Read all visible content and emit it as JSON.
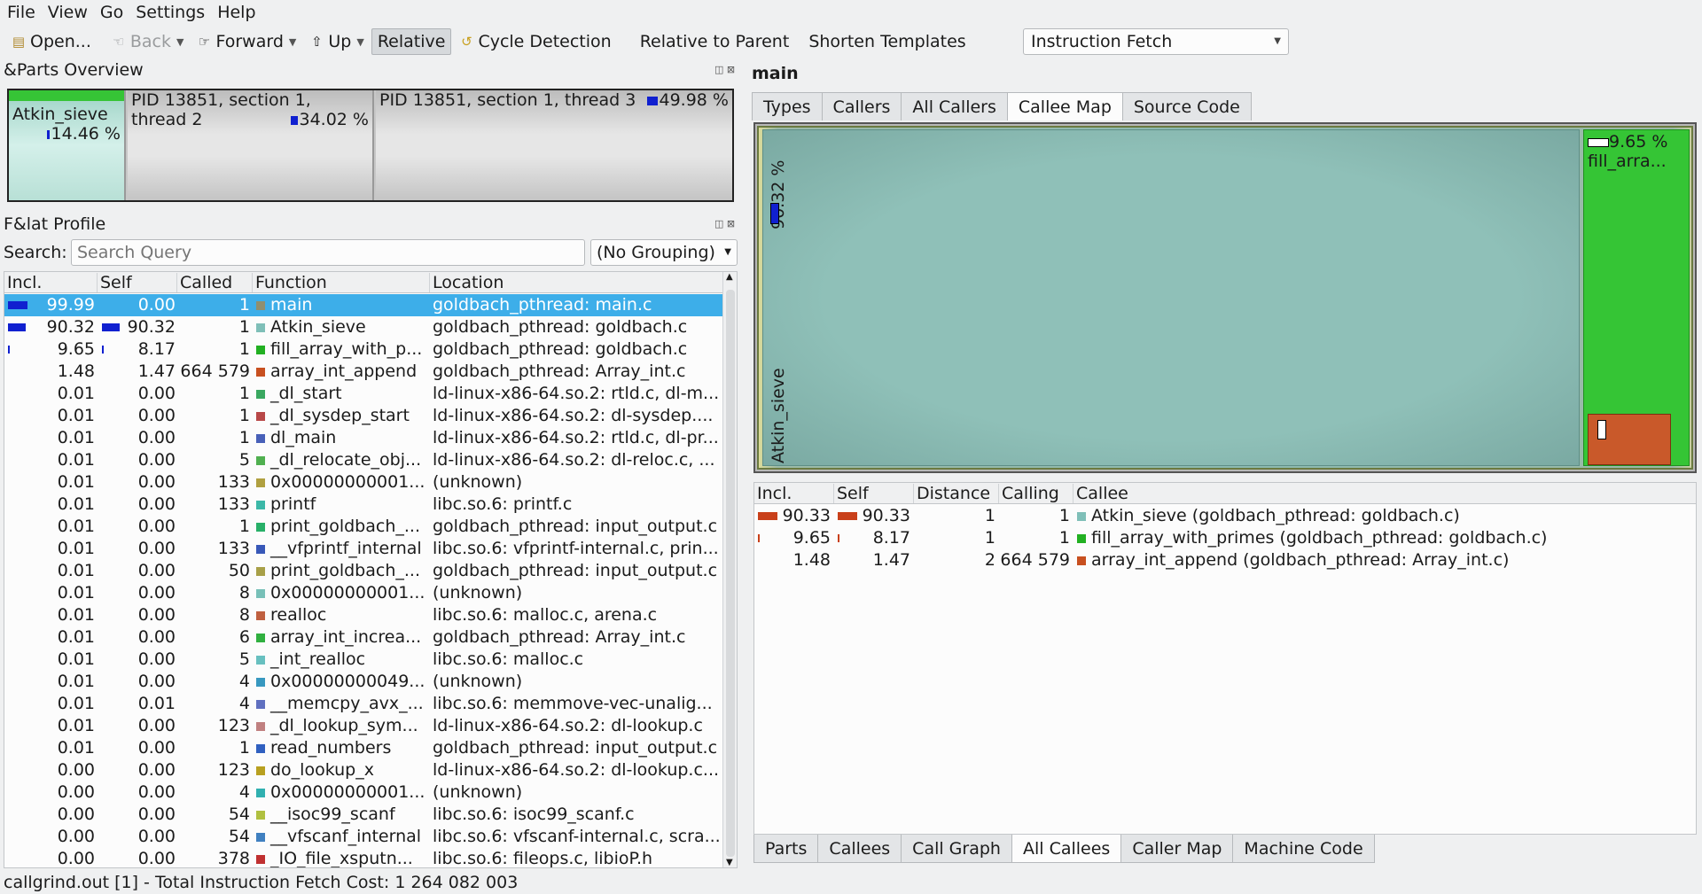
{
  "menu": [
    "File",
    "View",
    "Go",
    "Settings",
    "Help"
  ],
  "toolbar": {
    "open": "Open...",
    "back": "Back",
    "forward": "Forward",
    "up": "Up",
    "relative": "Relative",
    "cycle_detection": "Cycle Detection",
    "relative_to_parent": "Relative to Parent",
    "shorten_templates": "Shorten Templates",
    "event_type": "Instruction Fetch"
  },
  "parts_overview": {
    "title": "&Parts Overview",
    "parts": [
      {
        "label": "Atkin_sieve",
        "pct": "14.46 %"
      },
      {
        "label": "PID 13851, section 1, thread 2",
        "pct": "34.02 %"
      },
      {
        "label": "PID 13851, section 1, thread 3",
        "pct": "49.98 %"
      }
    ]
  },
  "flat_profile": {
    "title": "F&lat Profile",
    "search_label": "Search:",
    "search_placeholder": "Search Query",
    "grouping": "(No Grouping)",
    "columns": [
      "Incl.",
      "Self",
      "Called",
      "Function",
      "Location"
    ],
    "rows": [
      {
        "incl": "99.99",
        "self": "0.00",
        "called": "1",
        "function": "main",
        "location": "goldbach_pthread: main.c",
        "color": "#8f8f6f",
        "incl_bar": 99.99,
        "self_bar": 0
      },
      {
        "incl": "90.32",
        "self": "90.32",
        "called": "1",
        "function": "Atkin_sieve",
        "location": "goldbach_pthread: goldbach.c",
        "color": "#7fbfb8",
        "incl_bar": 90.32,
        "self_bar": 90.32
      },
      {
        "incl": "9.65",
        "self": "8.17",
        "called": "1",
        "function": "fill_array_with_p...",
        "location": "goldbach_pthread: goldbach.c",
        "color": "#22b022",
        "incl_bar": 9.65,
        "self_bar": 8.17
      },
      {
        "incl": "1.48",
        "self": "1.47",
        "called": "664 579",
        "function": "array_int_append",
        "location": "goldbach_pthread: Array_int.c",
        "color": "#c85020",
        "incl_bar": 0,
        "self_bar": 0
      },
      {
        "incl": "0.01",
        "self": "0.00",
        "called": "1",
        "function": "_dl_start",
        "location": "ld-linux-x86-64.so.2: rtld.c, dl-m...",
        "color": "#3aa860",
        "incl_bar": 0,
        "self_bar": 0
      },
      {
        "incl": "0.01",
        "self": "0.00",
        "called": "1",
        "function": "_dl_sysdep_start",
        "location": "ld-linux-x86-64.so.2: dl-sysdep....",
        "color": "#b84848",
        "incl_bar": 0,
        "self_bar": 0
      },
      {
        "incl": "0.01",
        "self": "0.00",
        "called": "1",
        "function": "dl_main",
        "location": "ld-linux-x86-64.so.2: rtld.c, dl-pr...",
        "color": "#4860b8",
        "incl_bar": 0,
        "self_bar": 0
      },
      {
        "incl": "0.01",
        "self": "0.00",
        "called": "5",
        "function": "_dl_relocate_obj...",
        "location": "ld-linux-x86-64.so.2: dl-reloc.c, ...",
        "color": "#50b050",
        "incl_bar": 0,
        "self_bar": 0
      },
      {
        "incl": "0.01",
        "self": "0.00",
        "called": "133",
        "function": "0x00000000001...",
        "location": "(unknown)",
        "color": "#b0a040",
        "incl_bar": 0,
        "self_bar": 0
      },
      {
        "incl": "0.01",
        "self": "0.00",
        "called": "133",
        "function": "printf",
        "location": "libc.so.6: printf.c",
        "color": "#3cb8a8",
        "incl_bar": 0,
        "self_bar": 0
      },
      {
        "incl": "0.01",
        "self": "0.00",
        "called": "1",
        "function": "print_goldbach_...",
        "location": "goldbach_pthread: input_output.c",
        "color": "#28b068",
        "incl_bar": 0,
        "self_bar": 0
      },
      {
        "incl": "0.01",
        "self": "0.00",
        "called": "133",
        "function": "__vfprintf_internal",
        "location": "libc.so.6: vfprintf-internal.c, prin...",
        "color": "#3858b8",
        "incl_bar": 0,
        "self_bar": 0
      },
      {
        "incl": "0.01",
        "self": "0.00",
        "called": "50",
        "function": "print_goldbach_...",
        "location": "goldbach_pthread: input_output.c",
        "color": "#a8a048",
        "incl_bar": 0,
        "self_bar": 0
      },
      {
        "incl": "0.01",
        "self": "0.00",
        "called": "8",
        "function": "0x00000000001...",
        "location": "(unknown)",
        "color": "#78c0b8",
        "incl_bar": 0,
        "self_bar": 0
      },
      {
        "incl": "0.01",
        "self": "0.00",
        "called": "8",
        "function": "realloc",
        "location": "libc.so.6: malloc.c, arena.c",
        "color": "#c06040",
        "incl_bar": 0,
        "self_bar": 0
      },
      {
        "incl": "0.01",
        "self": "0.00",
        "called": "6",
        "function": "array_int_increa...",
        "location": "goldbach_pthread: Array_int.c",
        "color": "#30b040",
        "incl_bar": 0,
        "self_bar": 0
      },
      {
        "incl": "0.01",
        "self": "0.00",
        "called": "5",
        "function": "_int_realloc",
        "location": "libc.so.6: malloc.c",
        "color": "#68c0c0",
        "incl_bar": 0,
        "self_bar": 0
      },
      {
        "incl": "0.01",
        "self": "0.00",
        "called": "4",
        "function": "0x00000000049...",
        "location": "(unknown)",
        "color": "#3898c0",
        "incl_bar": 0,
        "self_bar": 0
      },
      {
        "incl": "0.01",
        "self": "0.01",
        "called": "4",
        "function": "__memcpy_avx_...",
        "location": "libc.so.6: memmove-vec-unalig...",
        "color": "#6070c0",
        "incl_bar": 0,
        "self_bar": 0
      },
      {
        "incl": "0.01",
        "self": "0.00",
        "called": "123",
        "function": "_dl_lookup_sym...",
        "location": "ld-linux-x86-64.so.2: dl-lookup.c",
        "color": "#c08080",
        "incl_bar": 0,
        "self_bar": 0
      },
      {
        "incl": "0.01",
        "self": "0.00",
        "called": "1",
        "function": "read_numbers",
        "location": "goldbach_pthread: input_output.c",
        "color": "#3060c0",
        "incl_bar": 0,
        "self_bar": 0
      },
      {
        "incl": "0.00",
        "self": "0.00",
        "called": "123",
        "function": "do_lookup_x",
        "location": "ld-linux-x86-64.so.2: dl-lookup.c...",
        "color": "#b8a020",
        "incl_bar": 0,
        "self_bar": 0
      },
      {
        "incl": "0.00",
        "self": "0.00",
        "called": "4",
        "function": "0x00000000001...",
        "location": "(unknown)",
        "color": "#30b0b0",
        "incl_bar": 0,
        "self_bar": 0
      },
      {
        "incl": "0.00",
        "self": "0.00",
        "called": "54",
        "function": "__isoc99_scanf",
        "location": "libc.so.6: isoc99_scanf.c",
        "color": "#b0c040",
        "incl_bar": 0,
        "self_bar": 0
      },
      {
        "incl": "0.00",
        "self": "0.00",
        "called": "54",
        "function": "__vfscanf_internal",
        "location": "libc.so.6: vfscanf-internal.c, scra...",
        "color": "#4080c0",
        "incl_bar": 0,
        "self_bar": 0
      },
      {
        "incl": "0.00",
        "self": "0.00",
        "called": "378",
        "function": "_IO_file_xsputn...",
        "location": "libc.so.6: fileops.c, libioP.h",
        "color": "#c03030",
        "incl_bar": 0,
        "self_bar": 0
      }
    ]
  },
  "detail": {
    "function_name": "main",
    "top_tabs": [
      "Types",
      "Callers",
      "All Callers",
      "Callee Map",
      "Source Code"
    ],
    "top_active": "Callee Map",
    "treemap": {
      "atkin_label": "Atkin_sieve",
      "atkin_pct": "90.32 %",
      "fill_label": "fill_arra...",
      "fill_pct": "9.65 %"
    },
    "callees_columns": [
      "Incl.",
      "Self",
      "Distance",
      "Calling",
      "Callee"
    ],
    "callees": [
      {
        "incl": "90.33",
        "self": "90.33",
        "distance": "1",
        "calling": "1",
        "callee": "Atkin_sieve (goldbach_pthread: goldbach.c)",
        "color": "#7fbfb8",
        "incl_bar": 90.33,
        "self_bar": 90.33
      },
      {
        "incl": "9.65",
        "self": "8.17",
        "distance": "1",
        "calling": "1",
        "callee": "fill_array_with_primes (goldbach_pthread: goldbach.c)",
        "color": "#22b022",
        "incl_bar": 9.65,
        "self_bar": 8.17
      },
      {
        "incl": "1.48",
        "self": "1.47",
        "distance": "2",
        "calling": "664 579",
        "callee": "array_int_append (goldbach_pthread: Array_int.c)",
        "color": "#c85020",
        "incl_bar": 0,
        "self_bar": 0
      }
    ],
    "bottom_tabs": [
      "Parts",
      "Callees",
      "Call Graph",
      "All Callees",
      "Caller Map",
      "Machine Code"
    ],
    "bottom_active": "All Callees"
  },
  "status": "callgrind.out [1] - Total Instruction Fetch Cost: 1 264 082 003"
}
